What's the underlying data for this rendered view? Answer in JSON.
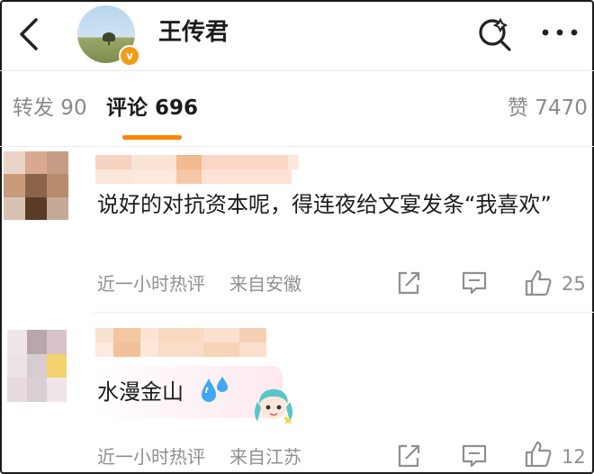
{
  "header": {
    "title": "王传君",
    "verified_badge": "v"
  },
  "tabs": [
    {
      "label": "转发 90",
      "active": false
    },
    {
      "label": "评论 696",
      "active": true
    },
    {
      "label": "赞 7470",
      "active": false
    }
  ],
  "comments": [
    {
      "text": "说好的对抗资本呢，得连夜给文宴发条“我喜欢”",
      "time": "近一小时热评",
      "location": "来自安徽",
      "likes": "25"
    },
    {
      "text": "水漫金山",
      "time": "近一小时热评",
      "location": "来自江苏",
      "likes": "12"
    }
  ],
  "colors": {
    "accent": "#ff8200",
    "verified": "#f29b1a",
    "meta": "#8f8f8f"
  },
  "icons": [
    "back-arrow-icon",
    "search-icon",
    "more-icon",
    "share-icon",
    "reply-icon",
    "thumbs-up-icon",
    "droplets-emoji-icon",
    "anime-character-emoji-icon"
  ]
}
